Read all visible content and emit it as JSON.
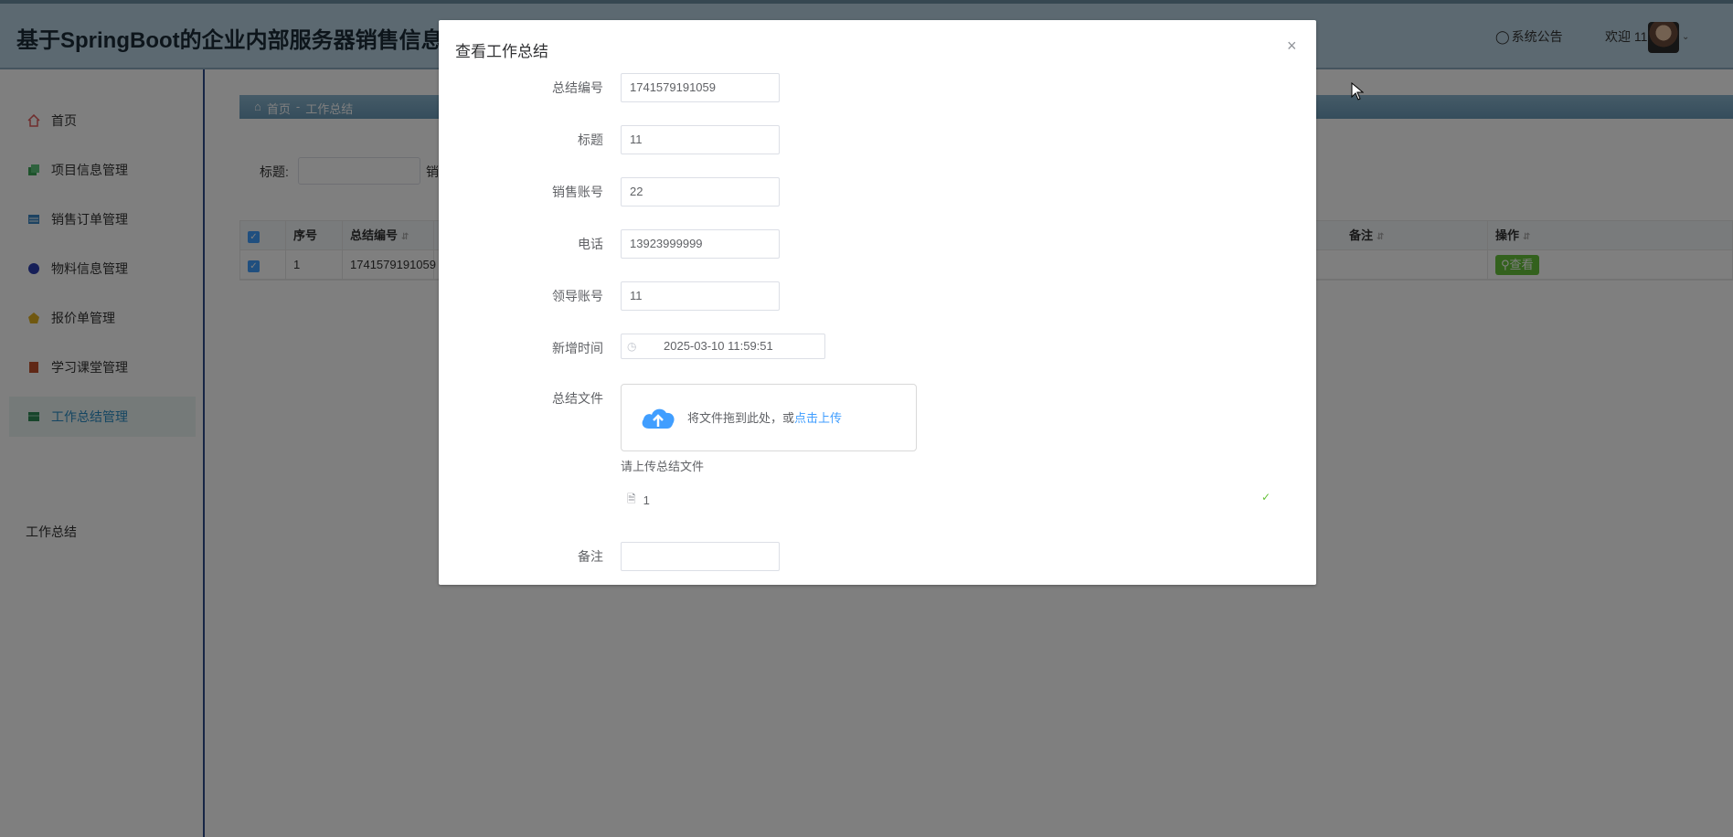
{
  "header": {
    "app_title": "基于SpringBoot的企业内部服务器销售信息管理",
    "announcement": "系统公告",
    "welcome": "欢迎 11"
  },
  "sidebar": {
    "items": [
      {
        "label": "首页",
        "icon": "home-icon",
        "color": "#e05b5b"
      },
      {
        "label": "项目信息管理",
        "icon": "layers-icon",
        "color": "#3aa657"
      },
      {
        "label": "销售订单管理",
        "icon": "list-icon",
        "color": "#3a86c4"
      },
      {
        "label": "物料信息管理",
        "icon": "circle-icon",
        "color": "#2d3fb0"
      },
      {
        "label": "报价单管理",
        "icon": "coin-icon",
        "color": "#e0b020"
      },
      {
        "label": "学习课堂管理",
        "icon": "book-icon",
        "color": "#c0502d"
      },
      {
        "label": "工作总结管理",
        "icon": "table-icon",
        "color": "#2e8b57"
      }
    ],
    "sub_item": "工作总结"
  },
  "breadcrumb": {
    "home": "首页",
    "separator": "-",
    "current": "工作总结"
  },
  "filter": {
    "title_label": "标题:",
    "next_label": "销"
  },
  "table": {
    "columns": [
      "序号",
      "总结编号",
      "备注",
      "操作"
    ],
    "rows": [
      {
        "index": "1",
        "code": "1741579191059",
        "remark": "",
        "action": "查看"
      }
    ]
  },
  "dialog": {
    "title": "查看工作总结",
    "close": "×",
    "fields": {
      "code_label": "总结编号",
      "code_value": "1741579191059",
      "title_label": "标题",
      "title_value": "11",
      "sales_label": "销售账号",
      "sales_value": "22",
      "phone_label": "电话",
      "phone_value": "13923999999",
      "leader_label": "领导账号",
      "leader_value": "11",
      "time_label": "新增时间",
      "time_value": "2025-03-10 11:59:51",
      "file_label": "总结文件",
      "remark_label": "备注",
      "remark_value": ""
    },
    "upload": {
      "text": "将文件拖到此处，或",
      "link": "点击上传",
      "tip": "请上传总结文件",
      "file_name": "1"
    }
  }
}
